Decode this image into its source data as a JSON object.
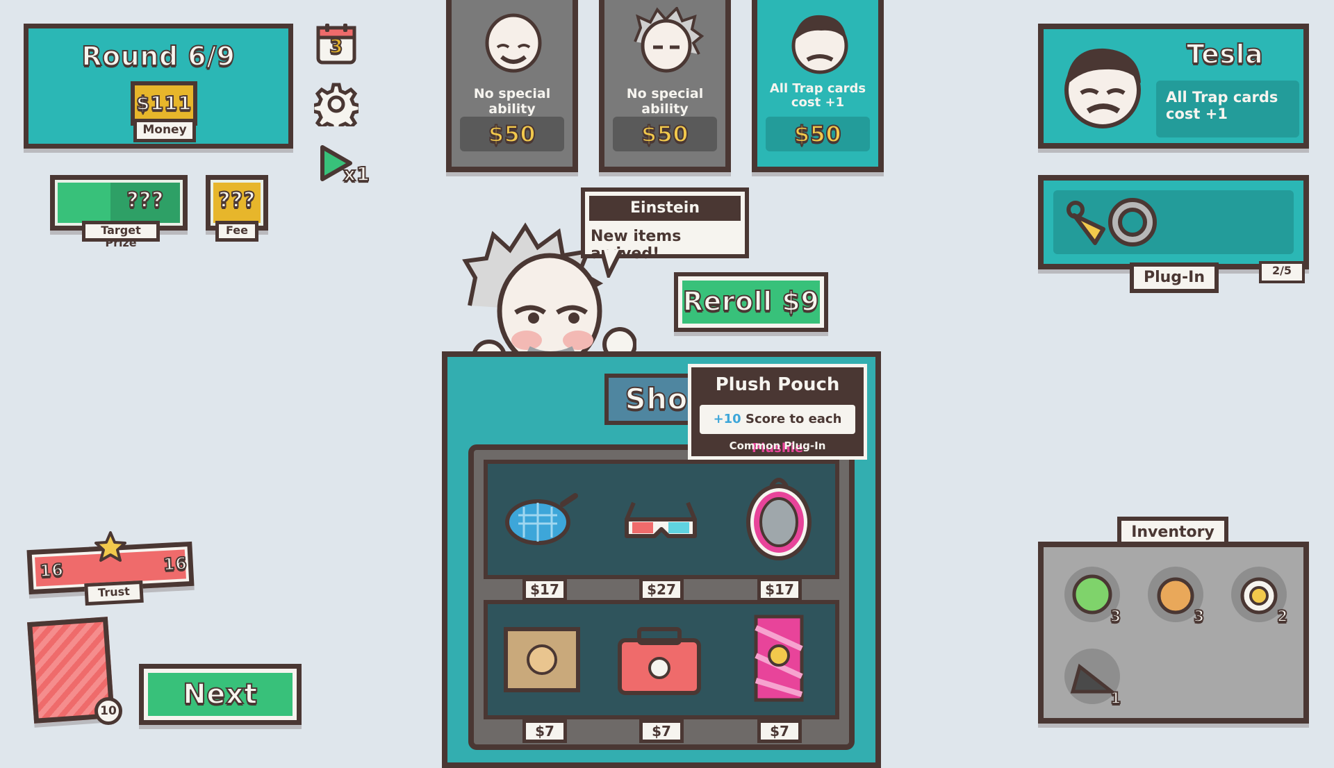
{
  "round": {
    "label": "Round 6/9"
  },
  "money": {
    "value": "$111",
    "label": "Money"
  },
  "calendar": {
    "day": "3"
  },
  "speed": {
    "label": "x1"
  },
  "target_prize": {
    "value": "???",
    "label": "Target Prize"
  },
  "fee": {
    "value": "???",
    "label": "Fee"
  },
  "cards": [
    {
      "ability": "No special ability",
      "price": "$50",
      "highlight": false
    },
    {
      "ability": "No special ability",
      "price": "$50",
      "highlight": false
    },
    {
      "ability": "All Trap cards cost +1",
      "price": "$50",
      "highlight": true
    }
  ],
  "shopkeeper": {
    "name": "Einstein",
    "message": "New items arrived!"
  },
  "reroll": {
    "label": "Reroll $9"
  },
  "shop": {
    "title": "Shop"
  },
  "tooltip": {
    "title": "Plush Pouch",
    "desc_prefix": "+10",
    "desc_mid": " Score to each ",
    "desc_highlight": "Plushie",
    "rarity": "Common Plug-In"
  },
  "shelf_items": [
    {
      "name": "Racket",
      "price": "$17"
    },
    {
      "name": "3D Glasses",
      "price": "$27"
    },
    {
      "name": "Pendant",
      "price": "$17"
    },
    {
      "name": "Plushie Box",
      "price": "$7"
    },
    {
      "name": "Toolbox",
      "price": "$7"
    },
    {
      "name": "Card Pack",
      "price": "$7"
    }
  ],
  "character": {
    "name": "Tesla",
    "ability": "All Trap cards cost +1"
  },
  "plugin": {
    "label": "Plug-In",
    "count": "2/5"
  },
  "inventory": {
    "label": "Inventory",
    "items": [
      {
        "name": "green plushie",
        "count": "3"
      },
      {
        "name": "orange plushie",
        "count": "3"
      },
      {
        "name": "flower plushie",
        "count": "2"
      },
      {
        "name": "shard",
        "count": "1"
      }
    ]
  },
  "trust": {
    "label": "Trust",
    "left": "16",
    "right": "16"
  },
  "deck": {
    "count": "10"
  },
  "next": {
    "label": "Next"
  },
  "colors": {
    "teal": "#2bb7b5",
    "outline": "#4a3733",
    "green": "#38c17a",
    "gold": "#e7b62b",
    "red": "#ef6b6b",
    "pink": "#e8449a",
    "blue": "#3da6d9"
  }
}
